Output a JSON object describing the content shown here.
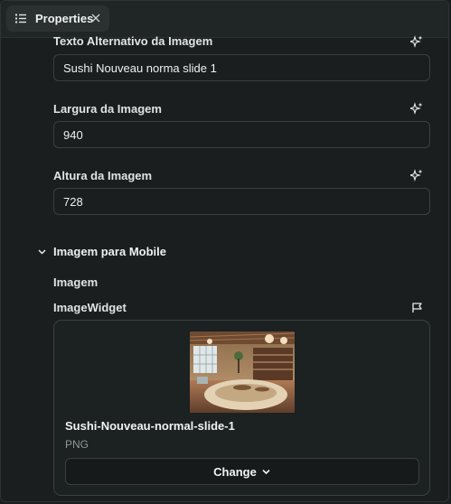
{
  "tab": {
    "label": "Properties",
    "icon": "list-icon",
    "close_icon": "close-icon"
  },
  "fields": {
    "alt_text": {
      "label": "Texto Alternativo da Imagem",
      "value": "Sushi Nouveau norma slide 1"
    },
    "width": {
      "label": "Largura da Imagem",
      "value": "940"
    },
    "height": {
      "label": "Altura da Imagem",
      "value": "728"
    }
  },
  "mobile_section": {
    "title": "Imagem para Mobile",
    "image_label": "Imagem",
    "widget_label": "ImageWidget",
    "image": {
      "name": "Sushi-Nouveau-normal-slide-1",
      "type": "PNG"
    },
    "change_label": "Change"
  },
  "colors": {
    "background": "#1a1e1e",
    "border": "#3a4040",
    "text": "#e8ecec",
    "muted": "#8f9797"
  }
}
